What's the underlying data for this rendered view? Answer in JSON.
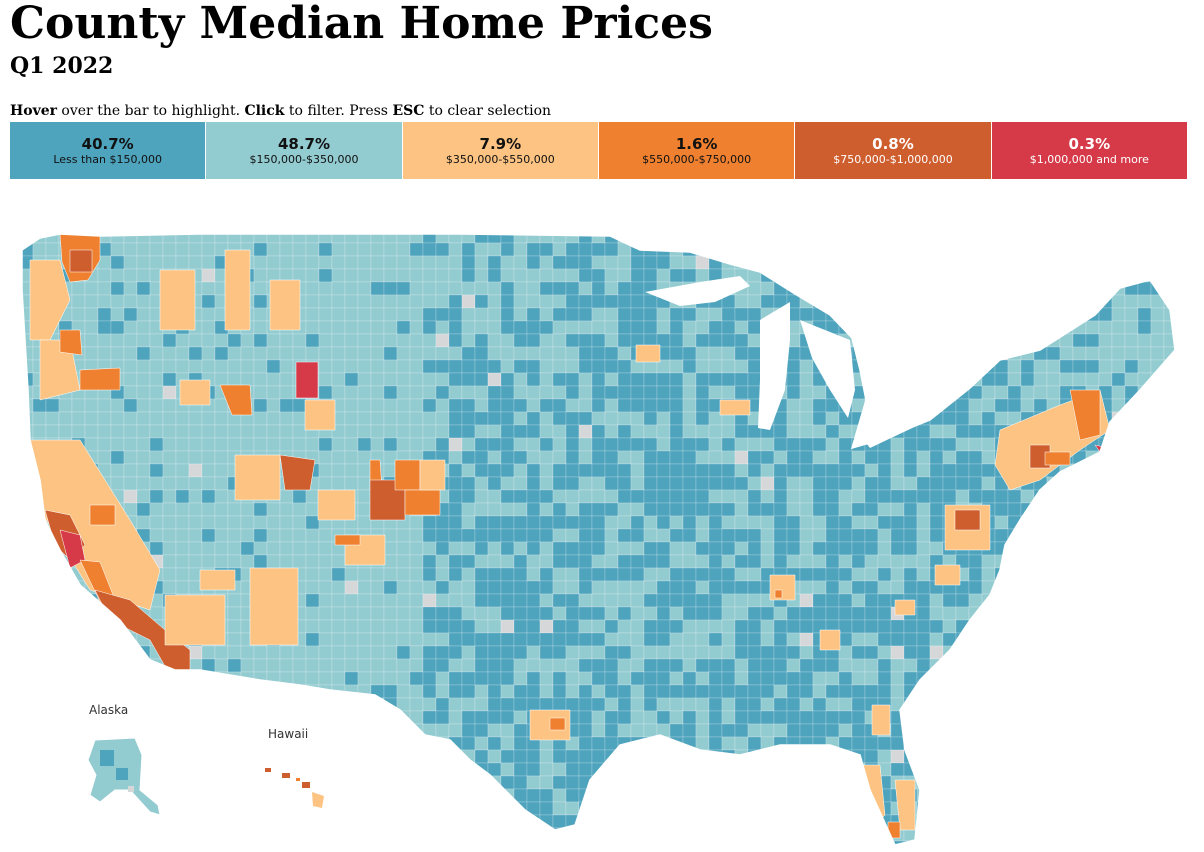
{
  "title": "County Median Home Prices",
  "subtitle": "Q1 2022",
  "instructions": {
    "hover_word": "Hover",
    "hover_rest": " over the bar to highlight. ",
    "click_word": "Click",
    "click_rest": " to filter. Press ",
    "esc_word": "ESC",
    "esc_rest": " to clear selection"
  },
  "legend": [
    {
      "pct": "40.7%",
      "range": "Less than $150,000",
      "color": "#4ea3bd",
      "text": "dark"
    },
    {
      "pct": "48.7%",
      "range": "$150,000-$350,000",
      "color": "#92cbd0",
      "text": "dark"
    },
    {
      "pct": "7.9%",
      "range": "$350,000-$550,000",
      "color": "#fcc382",
      "text": "dark"
    },
    {
      "pct": "1.6%",
      "range": "$550,000-$750,000",
      "color": "#ee8030",
      "text": "dark"
    },
    {
      "pct": "0.8%",
      "range": "$750,000-$1,000,000",
      "color": "#cf5e2f",
      "text": "light"
    },
    {
      "pct": "0.3%",
      "range": "$1,000,000 and more",
      "color": "#d63a49",
      "text": "light"
    }
  ],
  "insets": {
    "alaska": "Alaska",
    "hawaii": "Hawaii"
  },
  "colors": {
    "no_data": "#d5d7d9",
    "border": "#ffffff"
  }
}
